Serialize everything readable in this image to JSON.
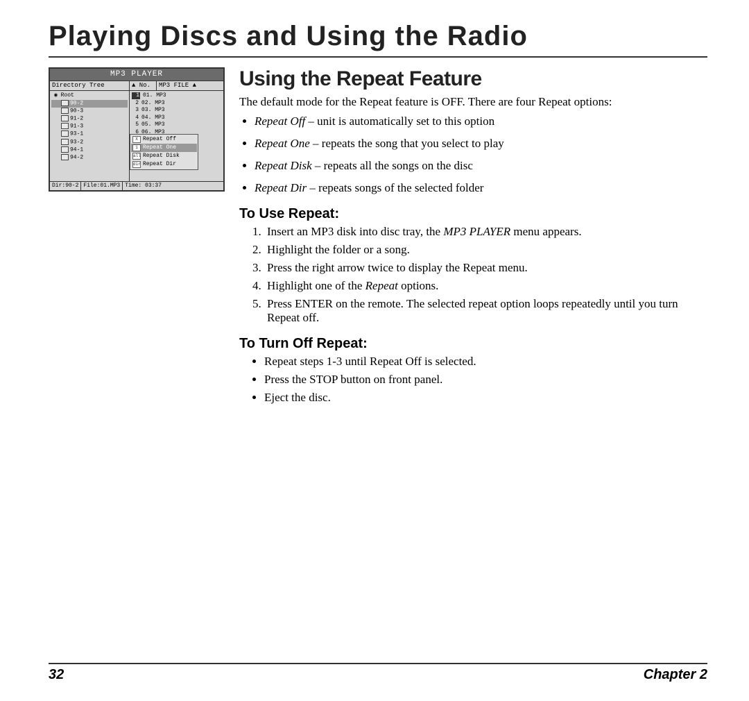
{
  "chapter_title": "Playing Discs and Using the Radio",
  "section_title": "Using the Repeat Feature",
  "lead": "The default mode for the Repeat feature is OFF. There are four Repeat options:",
  "options": [
    {
      "term": "Repeat Off",
      "desc": " – unit is automatically set to this option"
    },
    {
      "term": "Repeat One",
      "desc": " – repeats the song that you select to play"
    },
    {
      "term": "Repeat Disk",
      "desc": " – repeats all the songs on the disc"
    },
    {
      "term": "Repeat Dir",
      "desc": " – repeats songs of the selected folder"
    }
  ],
  "sub1_title": "To Use Repeat:",
  "steps_use": [
    {
      "pre": "Insert an MP3 disk into disc tray, the ",
      "em": "MP3 PLAYER",
      "post": " menu appears."
    },
    {
      "pre": "Highlight the folder or a song.",
      "em": "",
      "post": ""
    },
    {
      "pre": "Press the right arrow twice to display the Repeat menu.",
      "em": "",
      "post": ""
    },
    {
      "pre": "Highlight one of the ",
      "em": "Repeat",
      "post": "  options."
    },
    {
      "pre": "Press ENTER on the remote. The selected repeat option loops repeatedly until you turn Repeat off.",
      "em": "",
      "post": ""
    }
  ],
  "sub2_title": "To Turn Off Repeat:",
  "steps_off": [
    "Repeat steps 1-3 until Repeat Off is selected.",
    "Press the STOP button on front panel.",
    "Eject the disc."
  ],
  "footer": {
    "page": "32",
    "chapter": "Chapter 2"
  },
  "mp3": {
    "title": "MP3 PLAYER",
    "headers": {
      "h1": "Directory Tree",
      "h2": "▲ No.",
      "h3": "MP3 FILE ▲"
    },
    "tree_root": "Root",
    "tree": [
      "90-2",
      "90-3",
      "91-2",
      "91-3",
      "93-1",
      "93-2",
      "94-1",
      "94-2"
    ],
    "files": [
      {
        "n": "1",
        "name": "01. MP3"
      },
      {
        "n": "2",
        "name": "02. MP3"
      },
      {
        "n": "3",
        "name": "03. MP3"
      },
      {
        "n": "4",
        "name": "04. MP3"
      },
      {
        "n": "5",
        "name": "05. MP3"
      },
      {
        "n": "6",
        "name": "06. MP3"
      }
    ],
    "repeat_menu": [
      "Repeat Off",
      "Repeat One",
      "Repeat Disk",
      "Repeat Dir"
    ],
    "status": {
      "dir": "Dir:90-2",
      "file": "File:01.MP3",
      "time": "Time: 03:37"
    }
  }
}
